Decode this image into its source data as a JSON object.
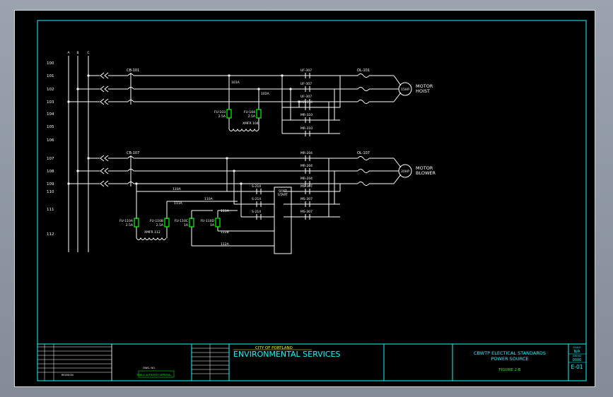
{
  "colors": {
    "background": "#000000",
    "frame": "#00ffff",
    "wire": "#ffffff",
    "fuse": "#00ff00",
    "text": "#ffffff",
    "title_text": "#00ffff",
    "logo_top": "#ffff00",
    "figure_text": "#00ff00"
  },
  "bus_labels": [
    "A",
    "B",
    "C"
  ],
  "rung_numbers": [
    "100",
    "101",
    "102",
    "103",
    "104",
    "105",
    "106",
    "107",
    "108",
    "109",
    "110",
    "111",
    "112"
  ],
  "breakers": [
    "CB-101",
    "CB-107"
  ],
  "overloads": [
    "OL-101",
    "OL-107"
  ],
  "motors": {
    "hoist": {
      "rating": "15HP",
      "label_line1": "MOTOR",
      "label_line2": "HOIST"
    },
    "blower": {
      "rating": "20HP",
      "label_line1": "MOTOR",
      "label_line2": "BLOWER"
    }
  },
  "contacts_upper": [
    "UF-307",
    "UF-307",
    "UF-307",
    "MR-310",
    "MR-310",
    "MR-310"
  ],
  "contacts_lower": [
    "MR-204",
    "MR-204",
    "MR-204",
    "MS-307",
    "MS-307",
    "MS-307"
  ],
  "starter_contacts": [
    "S-214",
    "S-214",
    "S-214"
  ],
  "soft_start": {
    "line1": "SOFT",
    "line2": "START"
  },
  "wire_labels": {
    "w101A": "101A",
    "w102A": "102A",
    "w110A": "110A",
    "w110A2": "110A",
    "w111A": "111A",
    "w111A2": "111A",
    "w112B": "112B",
    "w112A": "112A"
  },
  "fuses_upper": [
    {
      "name": "FU-103",
      "rating": "2.5A"
    },
    {
      "name": "FU-104",
      "rating": "2.5A"
    }
  ],
  "transformer_upper": {
    "name": "XMFR",
    "number": "104"
  },
  "fuses_lower": [
    {
      "name": "FU-110A",
      "rating": "2.5A"
    },
    {
      "name": "FU-110B",
      "rating": "2.5A"
    },
    {
      "name": "FU-110C",
      "rating": "1A"
    },
    {
      "name": "FU-110D",
      "rating": "1A"
    }
  ],
  "transformer_lower": {
    "name": "XMFR",
    "number": "112"
  },
  "title_block": {
    "logo_top": "CITY OF PORTLAND",
    "logo_main": "ENVIRONMENTAL SERVICES",
    "title_line1": "CBWTP ELECTICAL STANDARDS",
    "title_line2": "POWER SOURCE",
    "figure": "FIGURE 2-B",
    "sheet": "E-01",
    "scale_label": "SCALE",
    "scale_value": "N/A",
    "job_label": "JOB NO",
    "job_value": "0000",
    "revision_header": "REVISION",
    "drawing_no_label": "DWG. NO.",
    "approved_label": "PUBLIC AUTHORITY APPROVAL"
  }
}
